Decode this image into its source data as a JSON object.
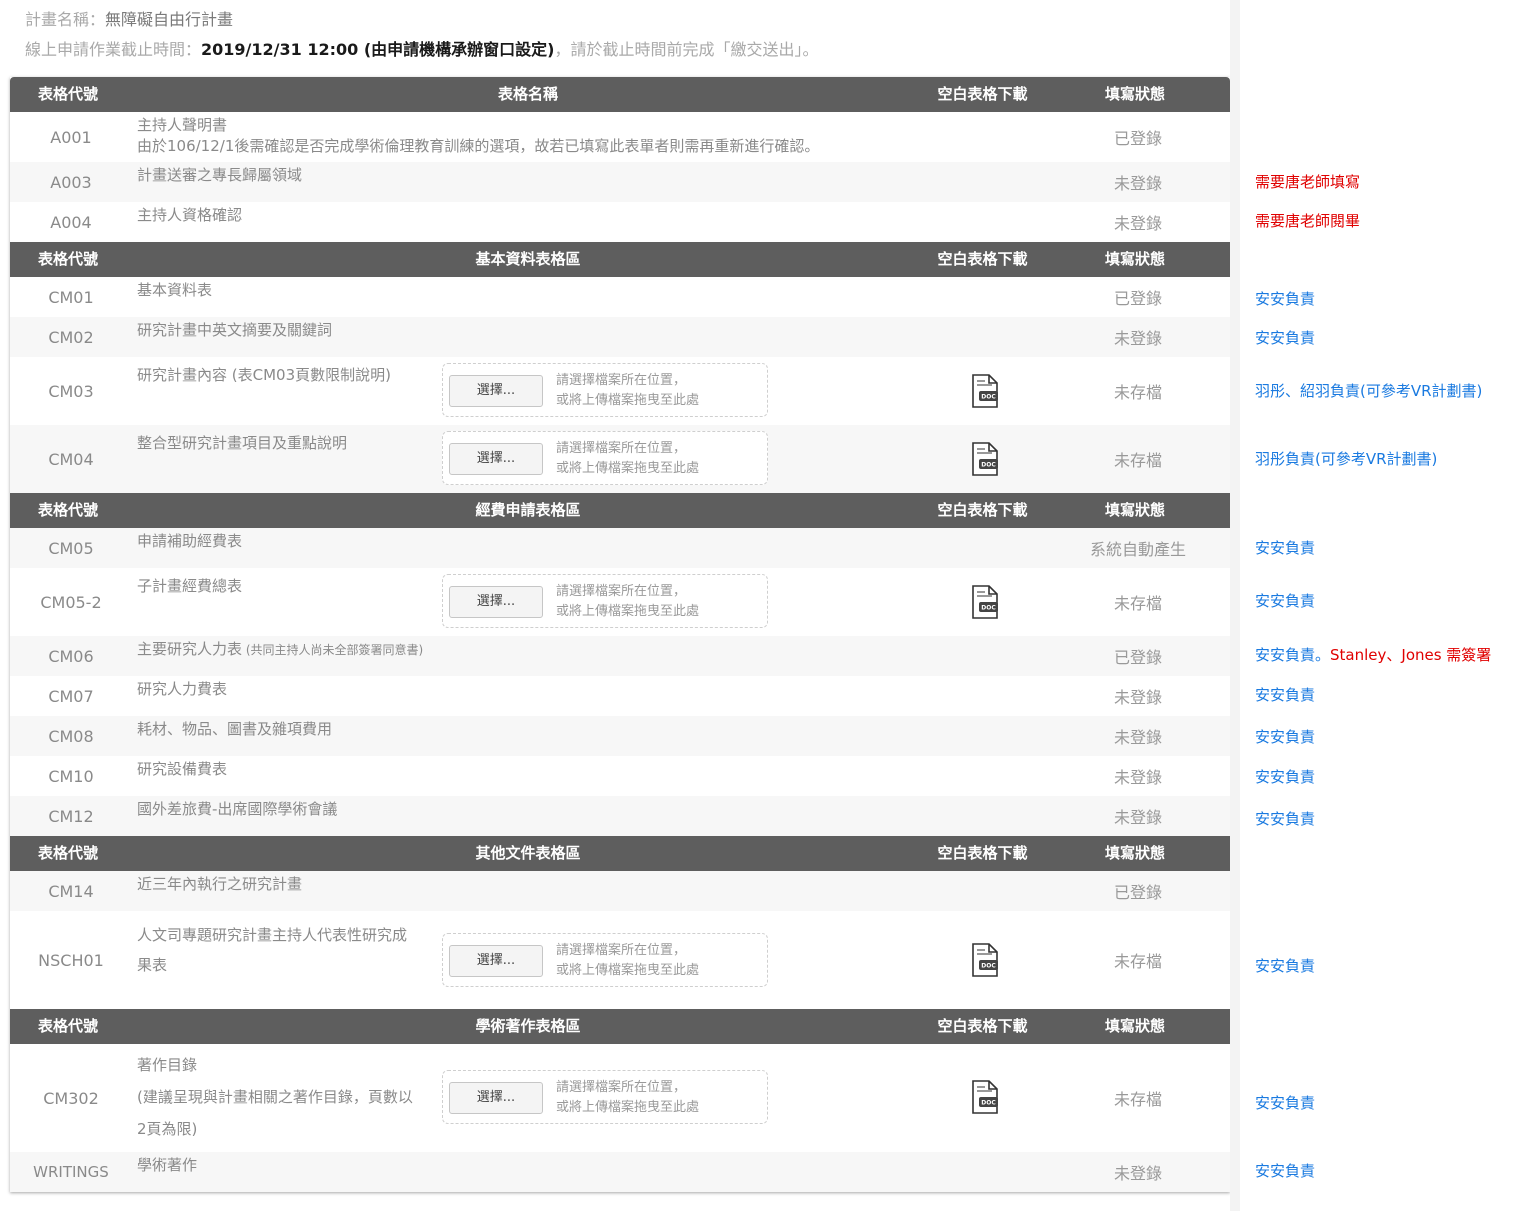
{
  "header": {
    "project_label": "計畫名稱：",
    "project_name": "無障礙自由行計畫",
    "deadline_label": "線上申請作業截止時間：",
    "deadline_value": "2019/12/31 12:00 (由申請機構承辦窗口設定)",
    "deadline_suffix": "，請於截止時間前完成「繳交送出」。"
  },
  "labels": {
    "choose_button": "選擇...",
    "upload_hint_line1": "請選擇檔案所在位置，",
    "upload_hint_line2": "或將上傳檔案拖曳至此處",
    "doc_icon_text": "DOC"
  },
  "sections": [
    {
      "h_code": "表格代號",
      "h_name": "表格名稱",
      "h_dl": "空白表格下載",
      "h_status": "填寫狀態",
      "rows": [
        {
          "code": "A001",
          "name": "主持人聲明書",
          "name2": "由於106/12/1後需確認是否完成學術倫理教育訓練的選項，故若已填寫此表單者則需再重新進行確認。",
          "status": "已登錄",
          "note": ""
        },
        {
          "code": "A003",
          "name": "計畫送審之專長歸屬領域",
          "status": "未登錄",
          "note": "需要唐老師填寫"
        },
        {
          "code": "A004",
          "name": "主持人資格確認",
          "status": "未登錄",
          "note": "需要唐老師閱畢"
        }
      ]
    },
    {
      "h_code": "表格代號",
      "h_name": "基本資料表格區",
      "h_dl": "空白表格下載",
      "h_status": "填寫狀態",
      "rows": [
        {
          "code": "CM01",
          "name": "基本資料表",
          "status": "已登錄",
          "note": "安安負責"
        },
        {
          "code": "CM02",
          "name": "研究計畫中英文摘要及關鍵詞",
          "status": "未登錄",
          "note": "安安負責"
        },
        {
          "code": "CM03",
          "name": "研究計畫內容 (表CM03頁數限制說明)",
          "status": "未存檔",
          "note": "羽彤、紹羽負責(可參考VR計劃書)"
        },
        {
          "code": "CM04",
          "name": "整合型研究計畫項目及重點說明",
          "status": "未存檔",
          "note": "羽彤負責(可參考VR計劃書)"
        }
      ]
    },
    {
      "h_code": "表格代號",
      "h_name": "經費申請表格區",
      "h_dl": "空白表格下載",
      "h_status": "填寫狀態",
      "rows": [
        {
          "code": "CM05",
          "name": "申請補助經費表",
          "status": "系統自動產生",
          "note": "安安負責"
        },
        {
          "code": "CM05-2",
          "name": "子計畫經費總表",
          "status": "未存檔",
          "note": "安安負責"
        },
        {
          "code": "CM06",
          "name": "主要研究人力表",
          "name_small": " (共同主持人尚未全部簽署同意書)",
          "status": "已登錄",
          "note": "安安負責。",
          "note_red": "Stanley、Jones 需簽署"
        },
        {
          "code": "CM07",
          "name": "研究人力費表",
          "status": "未登錄",
          "note": "安安負責"
        },
        {
          "code": "CM08",
          "name": "耗材、物品、圖書及雜項費用",
          "status": "未登錄",
          "note": "安安負責"
        },
        {
          "code": "CM10",
          "name": "研究設備費表",
          "status": "未登錄",
          "note": "安安負責"
        },
        {
          "code": "CM12",
          "name": "國外差旅費-出席國際學術會議",
          "status": "未登錄",
          "note": "安安負責"
        }
      ]
    },
    {
      "h_code": "表格代號",
      "h_name": "其他文件表格區",
      "h_dl": "空白表格下載",
      "h_status": "填寫狀態",
      "rows": [
        {
          "code": "CM14",
          "name": "近三年內執行之研究計畫",
          "status": "已登錄",
          "note": ""
        },
        {
          "code": "NSCH01",
          "name": "人文司專題研究計畫主持人代表性研究成",
          "name2": "果表",
          "status": "未存檔",
          "note": "安安負責"
        }
      ]
    },
    {
      "h_code": "表格代號",
      "h_name": "學術著作表格區",
      "h_dl": "空白表格下載",
      "h_status": "填寫狀態",
      "rows": [
        {
          "code": "CM302",
          "name": "著作目錄",
          "name2": "(建議呈現與計畫相關之著作目錄，頁數以",
          "name3": "2頁為限)",
          "status": "未存檔",
          "note": "安安負責"
        },
        {
          "code": "WRITINGS",
          "name": "學術著作",
          "status": "未登錄",
          "note": "安安負責"
        }
      ]
    }
  ]
}
